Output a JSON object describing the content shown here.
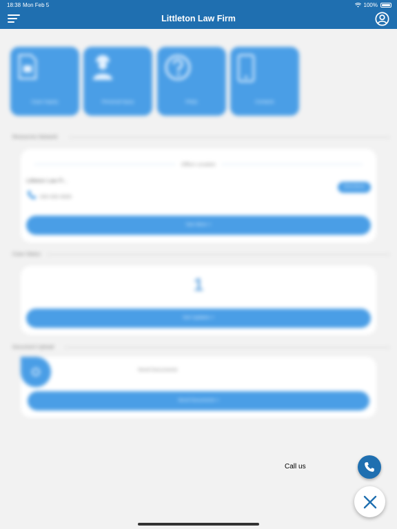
{
  "status_bar": {
    "time": "18:38",
    "date": "Mon Feb 5",
    "battery": "100%"
  },
  "nav": {
    "title": "Littleton Law Firm"
  },
  "tiles": [
    {
      "label": "Case Inquiry",
      "icon": "document-icon"
    },
    {
      "label": "Personal Injury",
      "icon": "worker-icon"
    },
    {
      "label": "FAQs",
      "icon": "question-icon"
    },
    {
      "label": "Contacts",
      "icon": "phone-device-icon"
    }
  ],
  "resources": {
    "section_title": "Resources Network",
    "divider_label": "Office Location",
    "office_name": "Littleton Law Fi...",
    "phone": "000 000 0000",
    "directions_label": "Directions",
    "see_more_label": "See More  >"
  },
  "case_status": {
    "section_title": "Case Status",
    "count": "1",
    "button_label": "Get Updates  >"
  },
  "document_upload": {
    "section_title": "Document Upload",
    "heading": "Send Documents",
    "button_label": "Send Documents  >"
  },
  "fab": {
    "call_label": "Call us"
  },
  "colors": {
    "primary": "#1f6fb0",
    "accent": "#4a9ee6",
    "background": "#f2f2f2"
  }
}
